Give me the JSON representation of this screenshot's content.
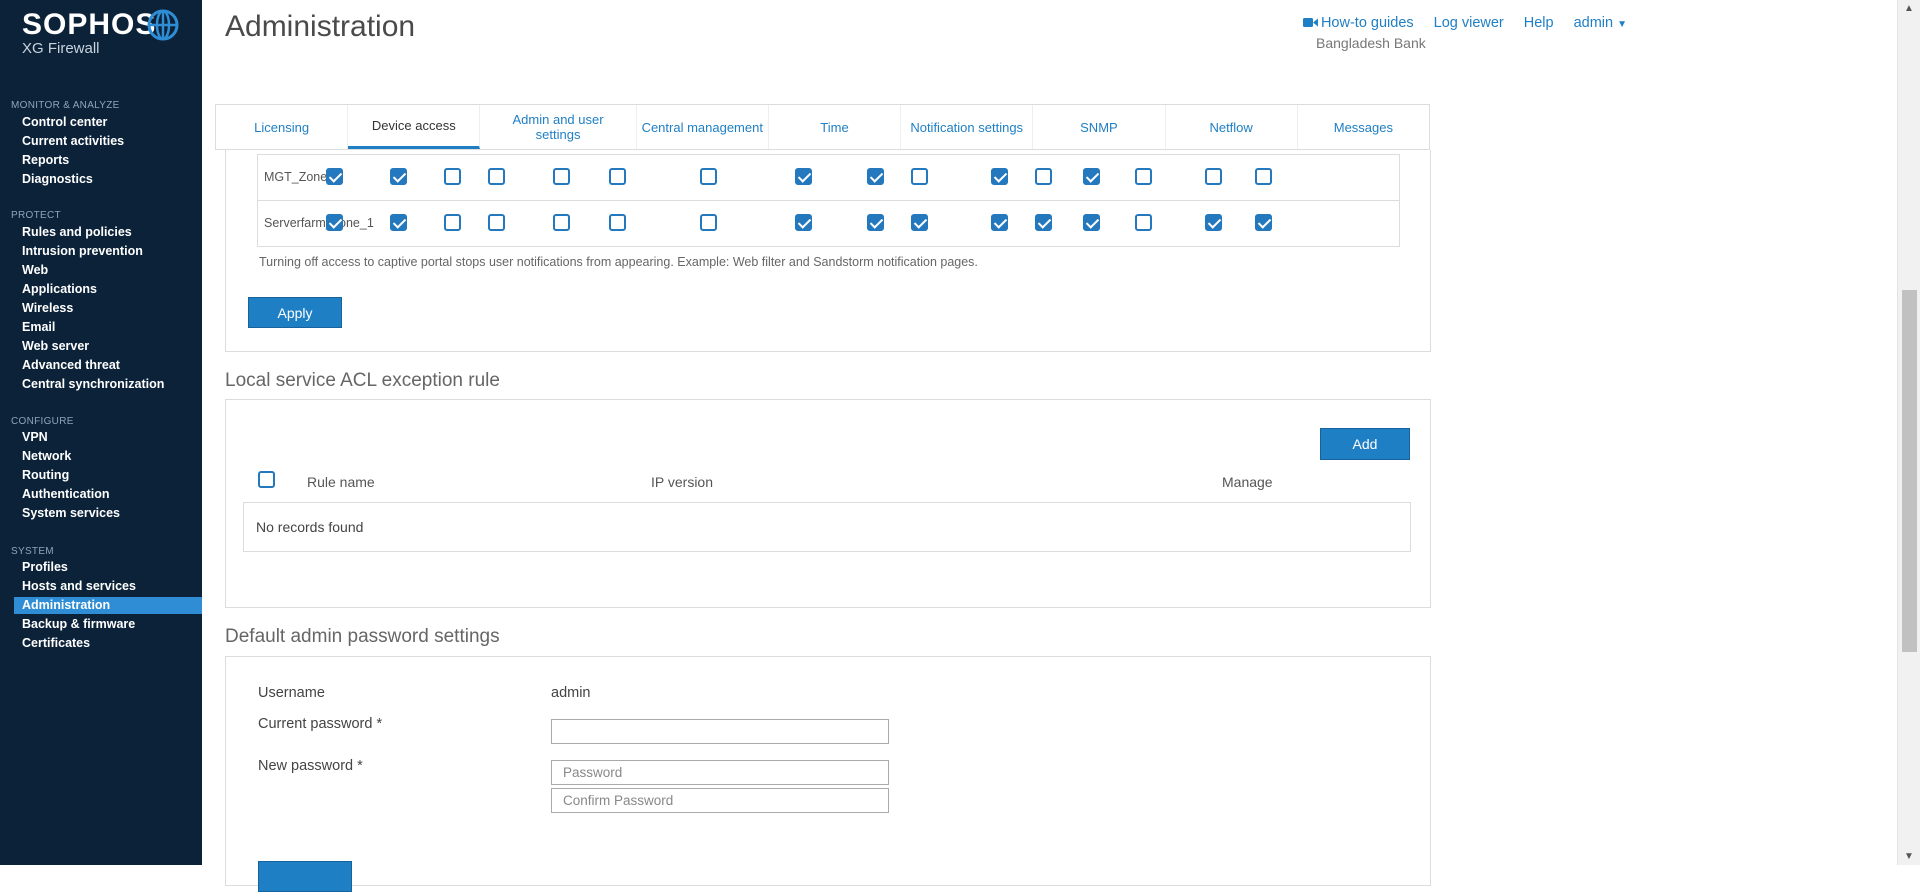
{
  "brand": {
    "name": "SOPHOS",
    "product": "XG Firewall"
  },
  "sidebar": {
    "sections": [
      {
        "title": "MONITOR & ANALYZE",
        "items": [
          "Control center",
          "Current activities",
          "Reports",
          "Diagnostics"
        ]
      },
      {
        "title": "PROTECT",
        "items": [
          "Rules and policies",
          "Intrusion prevention",
          "Web",
          "Applications",
          "Wireless",
          "Email",
          "Web server",
          "Advanced threat",
          "Central synchronization"
        ]
      },
      {
        "title": "CONFIGURE",
        "items": [
          "VPN",
          "Network",
          "Routing",
          "Authentication",
          "System services"
        ]
      },
      {
        "title": "SYSTEM",
        "items": [
          "Profiles",
          "Hosts and services",
          "Administration",
          "Backup & firmware",
          "Certificates"
        ]
      }
    ],
    "active_item": "Administration"
  },
  "header": {
    "title": "Administration",
    "links": {
      "howto": "How-to guides",
      "logviewer": "Log viewer",
      "help": "Help",
      "user": "admin"
    },
    "org": "Bangladesh Bank"
  },
  "tabs": [
    {
      "label": "Licensing",
      "active": false
    },
    {
      "label": "Device access",
      "active": true
    },
    {
      "label": "Admin and user settings",
      "active": false
    },
    {
      "label": "Central management",
      "active": false
    },
    {
      "label": "Time",
      "active": false
    },
    {
      "label": "Notification settings",
      "active": false
    },
    {
      "label": "SNMP",
      "active": false
    },
    {
      "label": "Netflow",
      "active": false
    },
    {
      "label": "Messages",
      "active": false
    }
  ],
  "acl_grid": {
    "rows": [
      {
        "zone": "MGT_Zone",
        "checks": [
          true,
          true,
          false,
          false,
          false,
          false,
          false,
          true,
          true,
          false,
          true,
          false,
          true,
          false,
          false,
          false
        ]
      },
      {
        "zone": "Serverfarm_zone_1",
        "checks": [
          true,
          true,
          false,
          false,
          false,
          false,
          false,
          true,
          true,
          true,
          true,
          true,
          true,
          false,
          true,
          true
        ]
      }
    ],
    "note": "Turning off access to captive portal stops user notifications from appearing. Example: Web filter and Sandstorm notification pages.",
    "apply_label": "Apply"
  },
  "exception_rule": {
    "title": "Local service ACL exception rule",
    "add_label": "Add",
    "columns": {
      "name": "Rule name",
      "ip": "IP version",
      "manage": "Manage"
    },
    "empty": "No records found"
  },
  "admin_password": {
    "title": "Default admin password settings",
    "username_label": "Username",
    "username_value": "admin",
    "current_label": "Current password *",
    "current_value": "",
    "new_label": "New password *",
    "new_placeholder": "Password",
    "confirm_placeholder": "Confirm Password"
  },
  "colors": {
    "sidebar_bg": "#0b2239",
    "accent": "#1f7fc4",
    "active_nav": "#2f8dd5"
  }
}
